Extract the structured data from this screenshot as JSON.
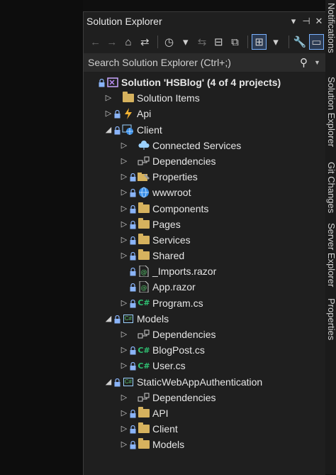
{
  "panel": {
    "title": "Solution Explorer",
    "title_buttons": [
      "▾",
      "⊣",
      "✕"
    ]
  },
  "search": {
    "placeholder": "Search Solution Explorer (Ctrl+;)"
  },
  "side_tabs": [
    "Notifications",
    "Solution Explorer",
    "Git Changes",
    "Server Explorer",
    "Properties"
  ],
  "tree": [
    {
      "label": "Solution 'HSBlog' (4 of 4 projects)",
      "depth": 0,
      "arrow": "",
      "lock": true,
      "icon": "solution-icon",
      "bold": true
    },
    {
      "label": "Solution Items",
      "depth": 1,
      "arrow": "▷",
      "lock": false,
      "icon": "folder-icon"
    },
    {
      "label": "Api",
      "depth": 1,
      "arrow": "▷",
      "lock": true,
      "icon": "azure-function-icon"
    },
    {
      "label": "Client",
      "depth": 1,
      "arrow": "◢",
      "lock": true,
      "icon": "web-project-icon"
    },
    {
      "label": "Connected Services",
      "depth": 2,
      "arrow": "▷",
      "lock": false,
      "icon": "connected-services-icon"
    },
    {
      "label": "Dependencies",
      "depth": 2,
      "arrow": "▷",
      "lock": false,
      "icon": "dependencies-icon"
    },
    {
      "label": "Properties",
      "depth": 2,
      "arrow": "▷",
      "lock": true,
      "icon": "properties-icon"
    },
    {
      "label": "wwwroot",
      "depth": 2,
      "arrow": "▷",
      "lock": true,
      "icon": "globe-icon"
    },
    {
      "label": "Components",
      "depth": 2,
      "arrow": "▷",
      "lock": true,
      "icon": "folder-icon"
    },
    {
      "label": "Pages",
      "depth": 2,
      "arrow": "▷",
      "lock": true,
      "icon": "folder-icon"
    },
    {
      "label": "Services",
      "depth": 2,
      "arrow": "▷",
      "lock": true,
      "icon": "folder-icon"
    },
    {
      "label": "Shared",
      "depth": 2,
      "arrow": "▷",
      "lock": true,
      "icon": "folder-icon"
    },
    {
      "label": "_Imports.razor",
      "depth": 2,
      "arrow": "",
      "lock": true,
      "icon": "razor-file-icon"
    },
    {
      "label": "App.razor",
      "depth": 2,
      "arrow": "",
      "lock": true,
      "icon": "razor-file-icon"
    },
    {
      "label": "Program.cs",
      "depth": 2,
      "arrow": "▷",
      "lock": true,
      "icon": "csharp-file-icon"
    },
    {
      "label": "Models",
      "depth": 1,
      "arrow": "◢",
      "lock": true,
      "icon": "csharp-project-icon"
    },
    {
      "label": "Dependencies",
      "depth": 2,
      "arrow": "▷",
      "lock": false,
      "icon": "dependencies-icon"
    },
    {
      "label": "BlogPost.cs",
      "depth": 2,
      "arrow": "▷",
      "lock": true,
      "icon": "csharp-file-icon"
    },
    {
      "label": "User.cs",
      "depth": 2,
      "arrow": "▷",
      "lock": true,
      "icon": "csharp-file-icon"
    },
    {
      "label": "StaticWebAppAuthentication",
      "depth": 1,
      "arrow": "◢",
      "lock": true,
      "icon": "csharp-project-icon"
    },
    {
      "label": "Dependencies",
      "depth": 2,
      "arrow": "▷",
      "lock": false,
      "icon": "dependencies-icon"
    },
    {
      "label": "API",
      "depth": 2,
      "arrow": "▷",
      "lock": true,
      "icon": "folder-icon"
    },
    {
      "label": "Client",
      "depth": 2,
      "arrow": "▷",
      "lock": true,
      "icon": "folder-icon"
    },
    {
      "label": "Models",
      "depth": 2,
      "arrow": "▷",
      "lock": true,
      "icon": "folder-icon"
    }
  ],
  "colors": {
    "background": "#1f1f1f",
    "folder": "#d6b25e",
    "lock": "#8ab4f8",
    "csharp": "#2fbf71",
    "accent_border": "#7ab3ff"
  }
}
